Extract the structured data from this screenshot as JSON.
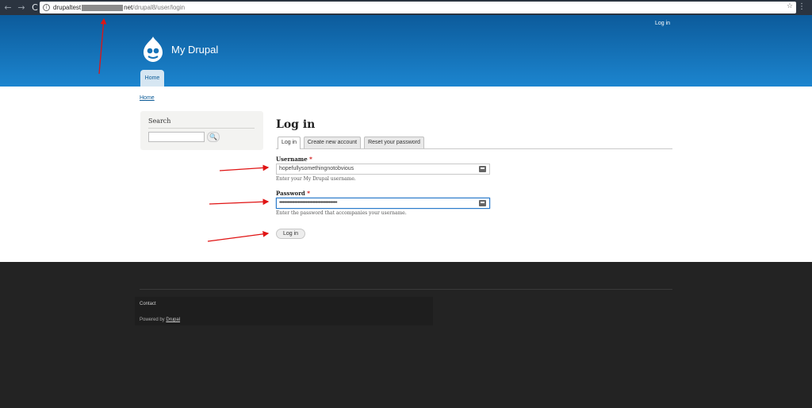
{
  "browser": {
    "url_host": "drupaltest",
    "url_host_suffix": "net",
    "url_path": "/drupal8/user/login",
    "back_glyph": "←",
    "forward_glyph": "→",
    "reload_glyph": "C",
    "info_glyph": "i",
    "star_glyph": "☆",
    "menu_glyph": "⋮"
  },
  "header": {
    "user_link": "Log in",
    "site_name": "My Drupal",
    "nav_tab": "Home"
  },
  "breadcrumb": "Home",
  "search_block": {
    "title": "Search",
    "button_glyph": "🔍",
    "input_value": ""
  },
  "login_form": {
    "title": "Log in",
    "tabs": [
      {
        "label": "Log in",
        "active": true
      },
      {
        "label": "Create new account",
        "active": false
      },
      {
        "label": "Reset your password",
        "active": false
      }
    ],
    "username": {
      "label": "Username",
      "required_mark": "*",
      "value": "hopefullysomethingnotobvious",
      "description": "Enter your My Drupal username."
    },
    "password": {
      "label": "Password",
      "required_mark": "*",
      "value": "••••••••••••••••••••••••••••••••••••••••••••••••••",
      "description": "Enter the password that accompanies your username."
    },
    "submit_label": "Log in"
  },
  "footer": {
    "contact_link": "Contact",
    "powered_prefix": "Powered by",
    "powered_link": "Drupal"
  },
  "colors": {
    "header_top": "#0c5b9b",
    "header_bottom": "#1c85cf",
    "annotation_arrow": "#e01414",
    "footer_bg": "#232323"
  }
}
